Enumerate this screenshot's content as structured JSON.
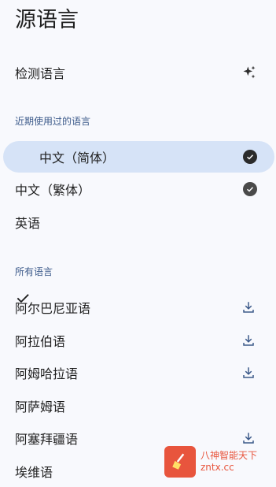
{
  "title": "源语言",
  "detect": {
    "label": "检测语言",
    "icon": "sparkle-icon"
  },
  "recent": {
    "header": "近期使用过的语言",
    "items": [
      {
        "label": "中文（简体）",
        "selected": true,
        "downloaded": true
      },
      {
        "label": "中文（繁体）",
        "selected": false,
        "downloaded": true
      },
      {
        "label": "英语",
        "selected": false,
        "downloaded": false
      }
    ]
  },
  "all": {
    "header": "所有语言",
    "items": [
      {
        "label": "阿尔巴尼亚语",
        "download": true
      },
      {
        "label": "阿拉伯语",
        "download": true
      },
      {
        "label": "阿姆哈拉语",
        "download": true
      },
      {
        "label": "阿萨姆语",
        "download": false
      },
      {
        "label": "阿塞拜疆语",
        "download": true
      },
      {
        "label": "埃维语",
        "download": false
      }
    ]
  },
  "watermark": {
    "line1": "八神智能天下",
    "line2": "zntx.cc"
  },
  "colors": {
    "background": "#f8f9fd",
    "selected": "#d6e3f7",
    "section": "#3c5a8a",
    "icon": "#3c5a8a",
    "watermark": "#e8553d"
  }
}
